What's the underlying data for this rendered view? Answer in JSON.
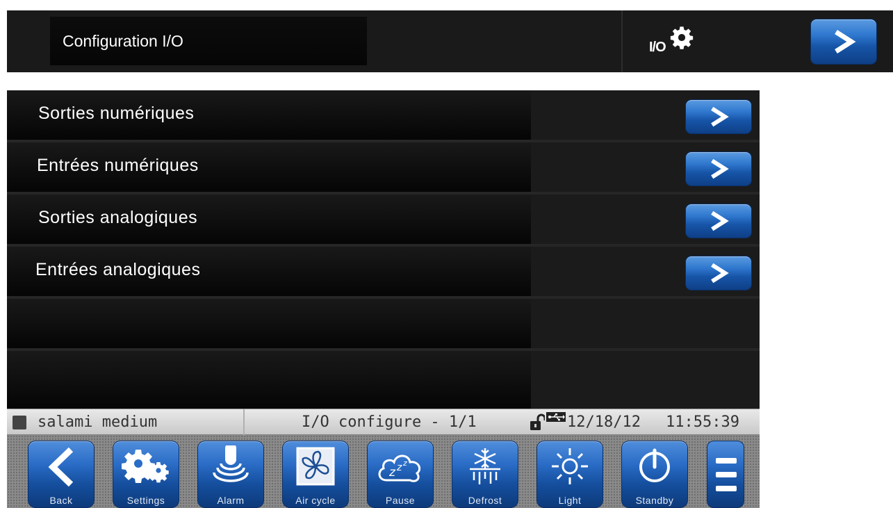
{
  "header": {
    "title": "Configuration I/O",
    "icon_text": "I/O",
    "icon_name": "io-settings-icon",
    "next_icon": "chevron-right-icon"
  },
  "menu": {
    "items": [
      {
        "label": "Sorties numériques"
      },
      {
        "label": "Entrées numériques"
      },
      {
        "label": "Sorties analogiques"
      },
      {
        "label": "Entrées analogiques"
      }
    ]
  },
  "status": {
    "recipe": "salami medium",
    "page": "I/O configure - 1/1",
    "date": "12/18/12",
    "time": "11:55:39",
    "icons": [
      "lock-open-icon",
      "usb-icon"
    ]
  },
  "toolbar": {
    "buttons": [
      {
        "label": "Back",
        "icon": "back-arrow-icon"
      },
      {
        "label": "Settings",
        "icon": "gears-icon"
      },
      {
        "label": "Alarm",
        "icon": "alarm-bell-icon"
      },
      {
        "label": "Air cycle",
        "icon": "fan-icon"
      },
      {
        "label": "Pause",
        "icon": "sleep-cloud-icon"
      },
      {
        "label": "Defrost",
        "icon": "defrost-icon"
      },
      {
        "label": "Light",
        "icon": "light-icon"
      },
      {
        "label": "Standby",
        "icon": "power-icon"
      }
    ],
    "menu_icon": "menu-icon"
  },
  "colors": {
    "accent_blue": "#2a6cc6",
    "panel_dark": "#121212",
    "status_bar": "#d9d9d9"
  }
}
